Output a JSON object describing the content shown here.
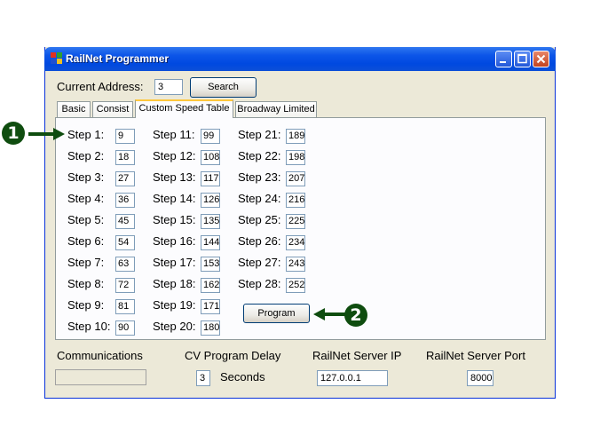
{
  "window": {
    "title": "RailNet Programmer",
    "buttons": [
      "minimize",
      "maximize",
      "close"
    ]
  },
  "address": {
    "label": "Current Address:",
    "value": "3",
    "search_label": "Search"
  },
  "tabs": [
    {
      "label": "Basic",
      "active": false
    },
    {
      "label": "Consist",
      "active": false
    },
    {
      "label": "Custom Speed Table",
      "active": true
    },
    {
      "label": "Broadway Limited",
      "active": false
    }
  ],
  "steps": [
    {
      "label": "Step 1:",
      "value": "9"
    },
    {
      "label": "Step 2:",
      "value": "18"
    },
    {
      "label": "Step 3:",
      "value": "27"
    },
    {
      "label": "Step 4:",
      "value": "36"
    },
    {
      "label": "Step 5:",
      "value": "45"
    },
    {
      "label": "Step 6:",
      "value": "54"
    },
    {
      "label": "Step 7:",
      "value": "63"
    },
    {
      "label": "Step 8:",
      "value": "72"
    },
    {
      "label": "Step 9:",
      "value": "81"
    },
    {
      "label": "Step 10:",
      "value": "90"
    },
    {
      "label": "Step 11:",
      "value": "99"
    },
    {
      "label": "Step 12:",
      "value": "108"
    },
    {
      "label": "Step 13:",
      "value": "117"
    },
    {
      "label": "Step 14:",
      "value": "126"
    },
    {
      "label": "Step 15:",
      "value": "135"
    },
    {
      "label": "Step 16:",
      "value": "144"
    },
    {
      "label": "Step 17:",
      "value": "153"
    },
    {
      "label": "Step 18:",
      "value": "162"
    },
    {
      "label": "Step 19:",
      "value": "171"
    },
    {
      "label": "Step 20:",
      "value": "180"
    },
    {
      "label": "Step 21:",
      "value": "189"
    },
    {
      "label": "Step 22:",
      "value": "198"
    },
    {
      "label": "Step 23:",
      "value": "207"
    },
    {
      "label": "Step 24:",
      "value": "216"
    },
    {
      "label": "Step 25:",
      "value": "225"
    },
    {
      "label": "Step 26:",
      "value": "234"
    },
    {
      "label": "Step 27:",
      "value": "243"
    },
    {
      "label": "Step 28:",
      "value": "252"
    }
  ],
  "program_label": "Program",
  "callouts": {
    "one": "1",
    "two": "2"
  },
  "status": {
    "communications_label": "Communications",
    "communications_value": "",
    "cv_delay_label": "CV Program Delay",
    "cv_delay_value": "3",
    "cv_delay_unit": "Seconds",
    "server_ip_label": "RailNet Server IP",
    "server_ip_value": "127.0.0.1",
    "server_port_label": "RailNet Server Port",
    "server_port_value": "8000"
  },
  "colors": {
    "titlebar": "#0c55e8",
    "callout": "#0f4d0f",
    "tab_highlight": "#ffc73c",
    "window_bg": "#ece9d8"
  }
}
